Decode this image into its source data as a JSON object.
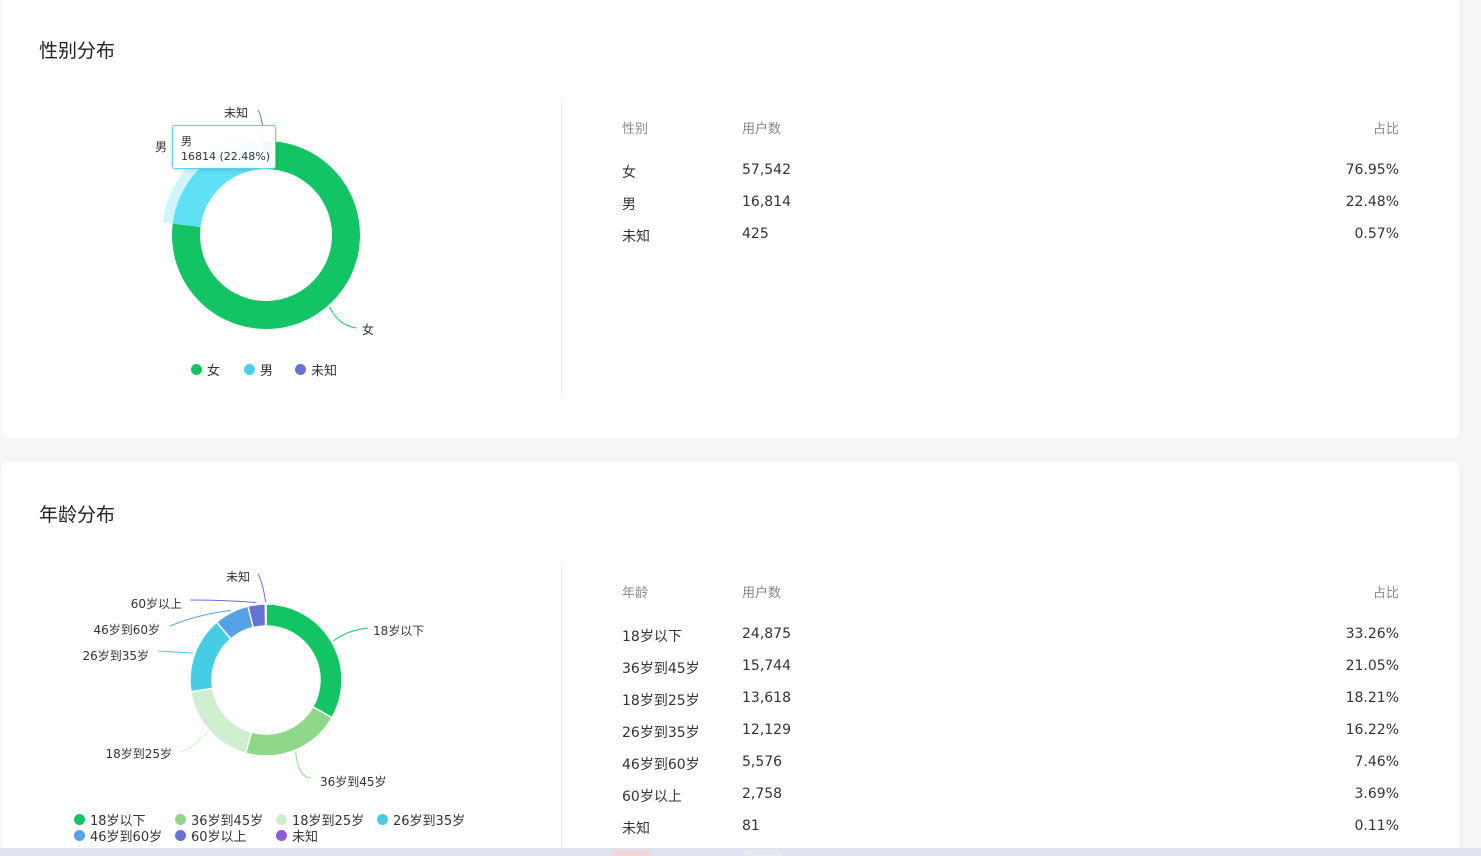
{
  "gender": {
    "title": "性别分布",
    "table": {
      "headers": [
        "性别",
        "用户数",
        "占比"
      ],
      "rows": [
        [
          "女",
          "57,542",
          "76.95%"
        ],
        [
          "男",
          "16,814",
          "22.48%"
        ],
        [
          "未知",
          "425",
          "0.57%"
        ]
      ]
    },
    "tooltip": {
      "name": "男",
      "value": "16814 (22.48%)"
    }
  },
  "age": {
    "title": "年龄分布",
    "table": {
      "headers": [
        "年龄",
        "用户数",
        "占比"
      ],
      "rows": [
        [
          "18岁以下",
          "24,875",
          "33.26%"
        ],
        [
          "36岁到45岁",
          "15,744",
          "21.05%"
        ],
        [
          "18岁到25岁",
          "13,618",
          "18.21%"
        ],
        [
          "26岁到35岁",
          "12,129",
          "16.22%"
        ],
        [
          "46岁到60岁",
          "5,576",
          "7.46%"
        ],
        [
          "60岁以上",
          "2,758",
          "3.69%"
        ],
        [
          "未知",
          "81",
          "0.11%"
        ]
      ]
    }
  },
  "chart_data": [
    {
      "type": "pie",
      "variant": "donut",
      "title": "性别分布",
      "categories": [
        "女",
        "男",
        "未知"
      ],
      "values": [
        57542,
        16814,
        425
      ],
      "colors": [
        "#12c463",
        "#5fe0f5",
        "#6772d4"
      ],
      "highlighted": "男",
      "legend_position": "bottom",
      "legend": [
        "女",
        "男",
        "未知"
      ],
      "legend_colors": [
        "#12c463",
        "#4dd1ea",
        "#6772d4"
      ]
    },
    {
      "type": "pie",
      "variant": "donut",
      "title": "年龄分布",
      "categories": [
        "18岁以下",
        "36岁到45岁",
        "18岁到25岁",
        "26岁到35岁",
        "46岁到60岁",
        "60岁以上",
        "未知"
      ],
      "values": [
        24875,
        15744,
        13618,
        12129,
        5576,
        2758,
        81
      ],
      "colors": [
        "#12c463",
        "#8fd88a",
        "#cfeecf",
        "#45cde5",
        "#56a2e8",
        "#6772d4",
        "#8b5bd6"
      ],
      "legend_position": "bottom",
      "legend": [
        "18岁以下",
        "36岁到45岁",
        "18岁到25岁",
        "26岁到35岁",
        "46岁到60岁",
        "60岁以上",
        "未知"
      ]
    }
  ]
}
